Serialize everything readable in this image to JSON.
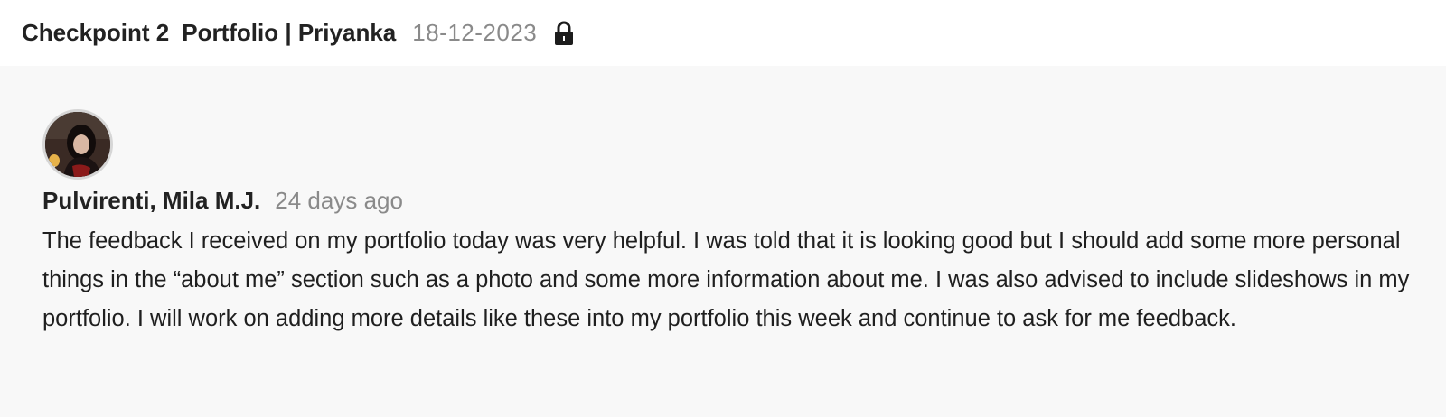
{
  "header": {
    "checkpoint_label": "Checkpoint 2",
    "page_title": "Portfolio | Priyanka",
    "date": "18-12-2023",
    "lock_icon": "lock-icon"
  },
  "comment": {
    "avatar_icon": "user-avatar",
    "author": "Pulvirenti, Mila M.J.",
    "time_ago": "24 days ago",
    "text": "The feedback I received on my portfolio today was very helpful. I was told that it is looking good but I should add some more personal things in the “about me” section such as a photo and some more information about me. I was also advised to include slideshows in my portfolio. I will work on adding more details like these into my portfolio this week and continue to ask for me feedback."
  },
  "colors": {
    "header_bg": "#ffffff",
    "content_bg": "#f8f8f8",
    "muted_text": "#8a8a8a",
    "primary_text": "#222222"
  }
}
